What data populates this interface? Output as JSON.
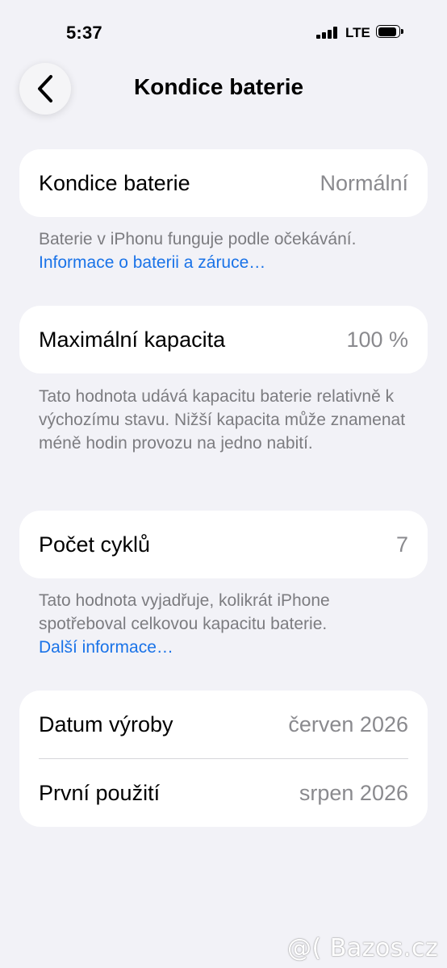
{
  "status_bar": {
    "time": "5:37",
    "network": "LTE"
  },
  "nav": {
    "title": "Kondice baterie",
    "back_icon": "chevron-left-icon"
  },
  "sections": {
    "health": {
      "label": "Kondice baterie",
      "value": "Normální",
      "footnote_text": "Baterie v iPhonu funguje podle očekávání.",
      "footnote_link": "Informace o baterii a záruce…"
    },
    "capacity": {
      "label": "Maximální kapacita",
      "value": "100 %",
      "footnote_text": "Tato hodnota udává kapacitu baterie relativně k výchozímu stavu. Nižší kapacita může znamenat méně hodin provozu na jedno nabití."
    },
    "cycles": {
      "label": "Počet cyklů",
      "value": "7",
      "footnote_text": "Tato hodnota vyjadřuje, kolikrát iPhone spotřeboval celkovou kapacitu baterie.",
      "footnote_link": "Další informace…"
    },
    "dates": {
      "manufacture_label": "Datum výroby",
      "manufacture_value": "červen 2026",
      "first_use_label": "První použití",
      "first_use_value": "srpen 2026"
    }
  },
  "watermark": "@( Bazos.cz",
  "colors": {
    "background": "#f2f2f7",
    "card": "#ffffff",
    "link": "#1a73e8",
    "secondary_text": "#8a8a8e"
  }
}
